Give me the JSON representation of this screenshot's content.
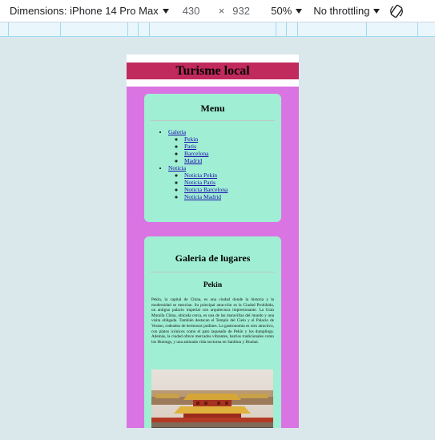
{
  "devtools": {
    "device_label": "Dimensions: iPhone 14 Pro Max",
    "width_value": "430",
    "times_sign": "×",
    "height_value": "932",
    "zoom_label": "50%",
    "throttling_label": "No throttling",
    "rotate_icon": "rotate-icon"
  },
  "page": {
    "header_title": "Turisme local",
    "menu": {
      "title": "Menu",
      "items": [
        {
          "label": "Galeria",
          "children": [
            "Pekin",
            "Paris",
            "Barcelona",
            "Madrid"
          ]
        },
        {
          "label": "Noticia",
          "children": [
            "Noticia Pekin",
            "Noticia Paris",
            "Noticia Barcelona",
            "Noticia Madrid"
          ]
        }
      ]
    },
    "gallery": {
      "title": "Galeria de lugares",
      "place_title": "Pekin",
      "description": "Pekín, la capital de China, es una ciudad donde la historia y la modernidad se mezclan. Su principal atracción es la Ciudad Prohibida, un antiguo palacio imperial con arquitectura impresionante. La Gran Muralla China, ubicada cerca, es una de las maravillas del mundo y una visita obligada. También destacan el Templo del Cielo y el Palacio de Verano, rodeados de hermosos jardines. La gastronomía es otro atractivo, con platos icónicos como el pato laqueado de Pekín y los dumplings. Además, la ciudad ofrece mercados vibrantes, barrios tradicionales como los Hutongs, y una animada vida nocturna en Sanlitun y Houhai."
    }
  },
  "colors": {
    "header": "#c12a5c",
    "main_bg": "#db74e3",
    "card_bg": "#a0eed4",
    "devtools_bg": "#dae8ec"
  }
}
